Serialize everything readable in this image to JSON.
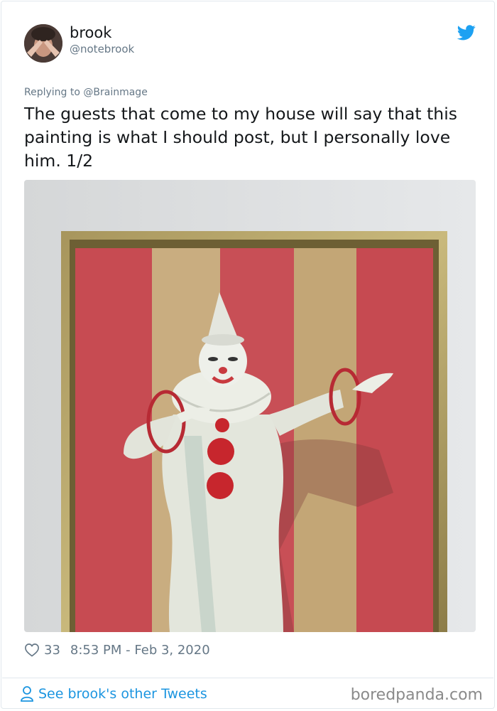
{
  "tweet": {
    "author_name": "brook",
    "author_handle": "@notebrook",
    "replying_prefix": "Replying to ",
    "replying_to": "@Brainmage",
    "text": "The guests that come to my house will say that this painting is what I should post, but I personally love him. 1/2",
    "like_count": "33",
    "timestamp": "8:53 PM - Feb 3, 2020"
  },
  "footer": {
    "see_more_label": "See brook's other Tweets",
    "watermark": "boredpanda.com"
  },
  "icons": {
    "brand": "twitter-bird-icon",
    "like": "heart-icon",
    "profile": "person-icon"
  },
  "colors": {
    "accent": "#1da1f2",
    "link": "#1b95e0",
    "muted": "#657786",
    "text": "#14171a"
  }
}
